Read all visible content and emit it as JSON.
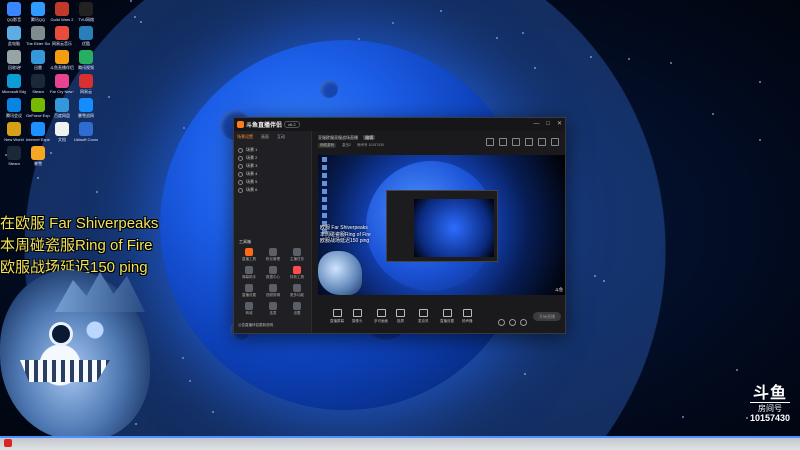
{
  "desktop_icons": [
    {
      "label": "QQ影音",
      "color": "#3a86ff"
    },
    {
      "label": "腾讯QQ",
      "color": "#2f9bff"
    },
    {
      "label": "Guild Wars 2",
      "color": "#c0392b"
    },
    {
      "label": "TVU网络",
      "color": "#222222"
    },
    {
      "label": "此电脑",
      "color": "#5dade2"
    },
    {
      "label": "The Elder Scrolls",
      "color": "#7f8c8d"
    },
    {
      "label": "网易云音乐",
      "color": "#e74c3c"
    },
    {
      "label": "优酷",
      "color": "#2980b9"
    },
    {
      "label": "回收站",
      "color": "#95a5a6"
    },
    {
      "label": "迅雷",
      "color": "#3498db"
    },
    {
      "label": "斗鱼直播伴侣",
      "color": "#f39c12"
    },
    {
      "label": "腾讯视频",
      "color": "#27ae60"
    },
    {
      "label": "Microsoft Edge",
      "color": "#0e9cd5"
    },
    {
      "label": "Steam",
      "color": "#1b2838"
    },
    {
      "label": "Far Cry New Dawn",
      "color": "#e84393"
    },
    {
      "label": "网易云",
      "color": "#d63031"
    },
    {
      "label": "腾讯会议",
      "color": "#0984e3"
    },
    {
      "label": "GeForce Experience",
      "color": "#76b900"
    },
    {
      "label": "百度网盘",
      "color": "#3498db"
    },
    {
      "label": "暴雪战网",
      "color": "#148eff"
    },
    {
      "label": "New World",
      "color": "#d4a017"
    },
    {
      "label": "Internet Explorer",
      "color": "#1e90ff"
    },
    {
      "label": "文档",
      "color": "#f1f1f1"
    },
    {
      "label": "Ubisoft Connect",
      "color": "#2e6cd1"
    },
    {
      "label": "Steam",
      "color": "#1b2838"
    },
    {
      "label": "暴雪",
      "color": "#f5a623"
    }
  ],
  "app": {
    "title": "斗鱼直播伴侣",
    "version": "v6.2",
    "window_controls": [
      "—",
      "□",
      "✕"
    ],
    "left_tabs": [
      "场景设置",
      "画面",
      "互动"
    ],
    "scenes": [
      "场景 1",
      "场景 2",
      "场景 3",
      "场景 4",
      "场景 5",
      "场景 6"
    ],
    "tools_title": "工具箱",
    "tools": [
      {
        "label": "直播工具",
        "color": "#ff6a1a"
      },
      {
        "label": "粉丝管理",
        "color": "#5a5f68"
      },
      {
        "label": "主播任务",
        "color": "#5a5f68"
      },
      {
        "label": "弹幕助手",
        "color": "#5a5f68"
      },
      {
        "label": "数据中心",
        "color": "#5a5f68"
      },
      {
        "label": "特效工具",
        "color": "#ff4d4f"
      },
      {
        "label": "直播设置",
        "color": "#5a5f68"
      },
      {
        "label": "视频剪辑",
        "color": "#5a5f68"
      },
      {
        "label": "更多功能",
        "color": "#5a5f68"
      },
      {
        "label": "商城",
        "color": "#5a5f68"
      },
      {
        "label": "连麦",
        "color": "#5a5f68"
      },
      {
        "label": "设置",
        "color": "#5a5f68"
      }
    ],
    "notice": "公告直播伴侣更新说明",
    "room_title": "亚服欧服双服战场直播",
    "room_tag": "编辑",
    "room_meta": [
      "网络游戏",
      "激战2",
      "房间号 10157430"
    ],
    "preview_overlay": [
      "欧服 Far Shiverpeaks",
      "本周碰瓷服Ring of Fire",
      "欧服战场延迟150 ping"
    ],
    "preview_badge": "斗鱼",
    "controls": [
      "直播屏幕",
      "摄像头",
      "多可画面",
      "投屏",
      "麦克风",
      "直播设置",
      "扬声器"
    ],
    "start_button": "开始直播"
  },
  "overlay_text": [
    "在欧服 Far Shiverpeaks",
    "本周碰瓷服Ring of Fire",
    "欧服战场延迟150 ping"
  ],
  "douyu": {
    "logo": "斗鱼",
    "room_label": "房间号",
    "room_id": "10157430"
  }
}
